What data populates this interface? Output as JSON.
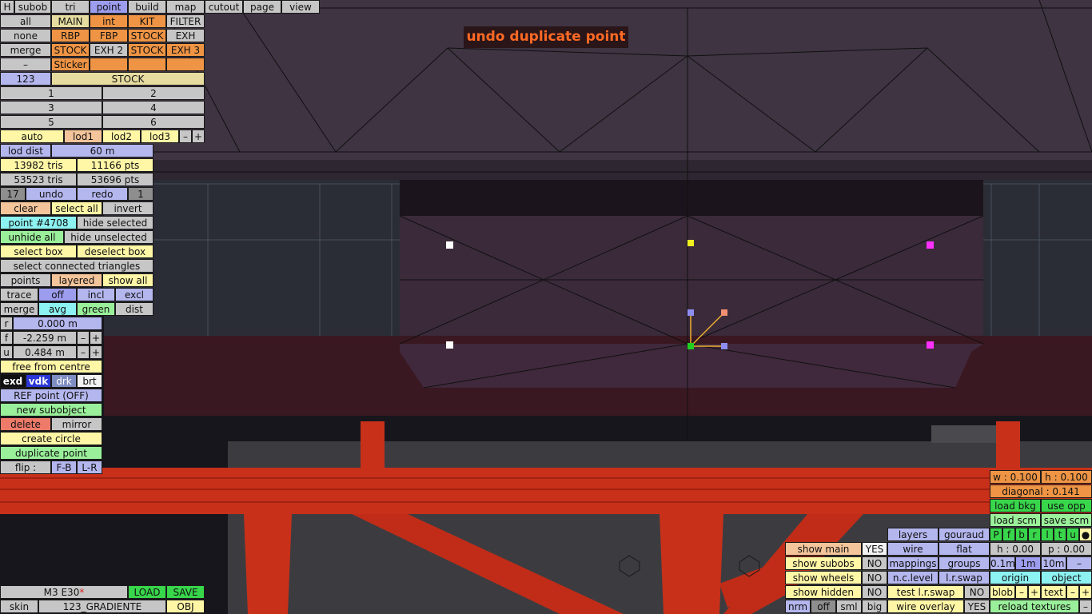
{
  "message": "undo duplicate point",
  "menu": {
    "h": "H",
    "subob": "subob",
    "tri": "tri",
    "point": "point",
    "build": "build",
    "map": "map",
    "cutout": "cutout",
    "page": "page",
    "view": "view"
  },
  "subobjects": {
    "row1": [
      "all",
      "MAIN",
      "int",
      "KIT",
      "FILTER"
    ],
    "row2": [
      "none",
      "RBP",
      "FBP",
      "STOCK",
      "EXH"
    ],
    "row3": [
      "merge",
      "STOCK",
      "EXH 2",
      "STOCK",
      "EXH 3"
    ],
    "row4": [
      "–",
      "Sticker",
      "",
      ""
    ],
    "current_num": "123",
    "current_name": "STOCK"
  },
  "numbers": [
    "1",
    "2",
    "3",
    "4",
    "5",
    "6"
  ],
  "lod": {
    "auto": "auto",
    "lod1": "lod1",
    "lod2": "lod2",
    "lod3": "lod3",
    "minus": "–",
    "plus": "+"
  },
  "lod_dist": {
    "label": "lod dist",
    "value": "60 m"
  },
  "stats": {
    "tris1": "13982 tris",
    "pts1": "11166 pts",
    "tris2": "53523 tris",
    "pts2": "53696 pts"
  },
  "undo_row": {
    "count": "17",
    "undo": "undo",
    "redo": "redo",
    "redo_count": "1"
  },
  "point_tools": {
    "clear": "clear",
    "select_all": "select all",
    "invert": "invert",
    "point_id": "point #4708",
    "hide_selected": "hide selected",
    "unhide_all": "unhide all",
    "hide_unselected": "hide unselected",
    "select_box": "select box",
    "deselect_box": "deselect box",
    "select_connected": "select connected triangles",
    "points": "points",
    "layered": "layered",
    "show_all": "show all",
    "trace": "trace",
    "off": "off",
    "incl": "incl",
    "excl": "excl",
    "merge": "merge",
    "avg": "avg",
    "green": "green",
    "dist": "dist"
  },
  "coords": {
    "r_label": "r",
    "r_value": "0.000 m",
    "f_label": "f",
    "f_value": "-2.259 m",
    "u_label": "u",
    "u_value": "0.484 m",
    "minus": "–",
    "plus": "+"
  },
  "more_tools": {
    "free_from_centre": "free from centre",
    "exd": "exd",
    "vdk": "vdk",
    "drk": "drk",
    "brt": "brt",
    "ref_point": "REF point (OFF)",
    "new_subobject": "new subobject",
    "delete": "delete",
    "mirror": "mirror",
    "create_circle": "create circle",
    "duplicate_point": "duplicate point",
    "flip": "flip :",
    "fb": "F-B",
    "lr": "L-R"
  },
  "file": {
    "model": "M3 E30",
    "modified_mark": "*",
    "load": "LOAD",
    "save": "SAVE",
    "skin_label": "skin",
    "skin_name": "123_GRADIENTE",
    "obj": "OBJ"
  },
  "view_panel": {
    "show_main": "show main",
    "show_main_val": "YES",
    "show_subobs": "show subobs",
    "show_subobs_val": "NO",
    "show_wheels": "show wheels",
    "show_wheels_val": "NO",
    "show_hidden": "show hidden",
    "show_hidden_val": "NO",
    "nrm": "nrm",
    "off": "off",
    "sml": "sml",
    "big": "big",
    "layers": "layers",
    "gouraud": "gouraud",
    "wire": "wire",
    "flat": "flat",
    "mappings": "mappings",
    "groups": "groups",
    "nc_level": "n.c.level",
    "lr_swap": "l.r.swap",
    "test_lr_swap": "test l.r.swap",
    "test_lr_swap_val": "NO",
    "wire_overlay": "wire overlay",
    "wire_overlay_val": "YES"
  },
  "grid_panel": {
    "w": "w : 0.100",
    "h": "h : 0.100",
    "diagonal": "diagonal : 0.141",
    "load_bkg": "load bkg",
    "use_opp": "use opp",
    "load_scm": "load scm",
    "save_scm": "save scm",
    "views": [
      "P",
      "f",
      "b",
      "r",
      "l",
      "t",
      "u",
      "●"
    ],
    "h_val": "h : 0.00",
    "p_val": "p : 0.00",
    "s01": "0.1m",
    "s1": "1m",
    "s10": "10m",
    "sminus": "–",
    "origin": "origin",
    "object": "object",
    "blob": "blob",
    "blob_minus": "–",
    "blob_plus": "+",
    "text": "text",
    "text_minus": "–",
    "text_plus": "+",
    "reload_textures": "reload textures",
    "rt_minus": "–"
  },
  "colors": {
    "accent_orange": "#ee9444",
    "selected_blue": "#9d9df0",
    "message": "#ff6a24"
  }
}
